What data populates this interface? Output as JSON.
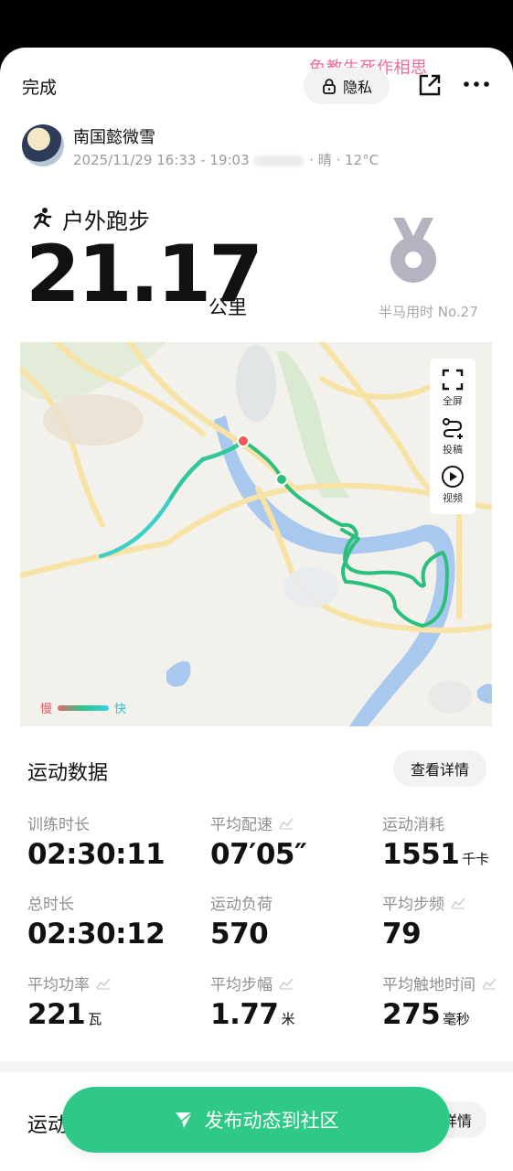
{
  "header": {
    "done_label": "完成",
    "watermark": "免教生死作相思",
    "privacy_label": "隐私"
  },
  "user": {
    "name": "南国懿微雪",
    "time_range": "2025/11/29 16:33 - 19:03",
    "weather": "· 晴 · 12°C"
  },
  "activity": {
    "type": "户外跑步",
    "distance": "21.17",
    "unit": "公里",
    "medal_label": "半马用时 No.27"
  },
  "map": {
    "tools": [
      {
        "label": "全屏",
        "icon": "fullscreen-icon"
      },
      {
        "label": "投稿",
        "icon": "route-submit-icon"
      },
      {
        "label": "视频",
        "icon": "play-video-icon"
      }
    ],
    "legend_slow": "慢",
    "legend_fast": "快"
  },
  "stats": {
    "title": "运动数据",
    "details_label": "查看详情",
    "items": [
      {
        "label": "训练时长",
        "value": "02:30:11",
        "unit": ""
      },
      {
        "label": "平均配速",
        "value": "07′05″",
        "unit": ""
      },
      {
        "label": "运动消耗",
        "value": "1551",
        "unit": "千卡"
      },
      {
        "label": "总时长",
        "value": "02:30:12",
        "unit": ""
      },
      {
        "label": "运动负荷",
        "value": "570",
        "unit": ""
      },
      {
        "label": "平均步频",
        "value": "79",
        "unit": ""
      },
      {
        "label": "平均功率",
        "value": "221",
        "unit": "瓦"
      },
      {
        "label": "平均步幅",
        "value": "1.77",
        "unit": "米"
      },
      {
        "label": "平均触地时间",
        "value": "275",
        "unit": "毫秒"
      }
    ]
  },
  "section2": {
    "title": "运动",
    "details_label": "详情"
  },
  "fab": {
    "label": "发布动态到社区"
  },
  "colors": {
    "accent": "#2ec986",
    "route_start": "#ee5a5a",
    "route": "#2bbf7e",
    "watermark": "#f06b9c"
  }
}
